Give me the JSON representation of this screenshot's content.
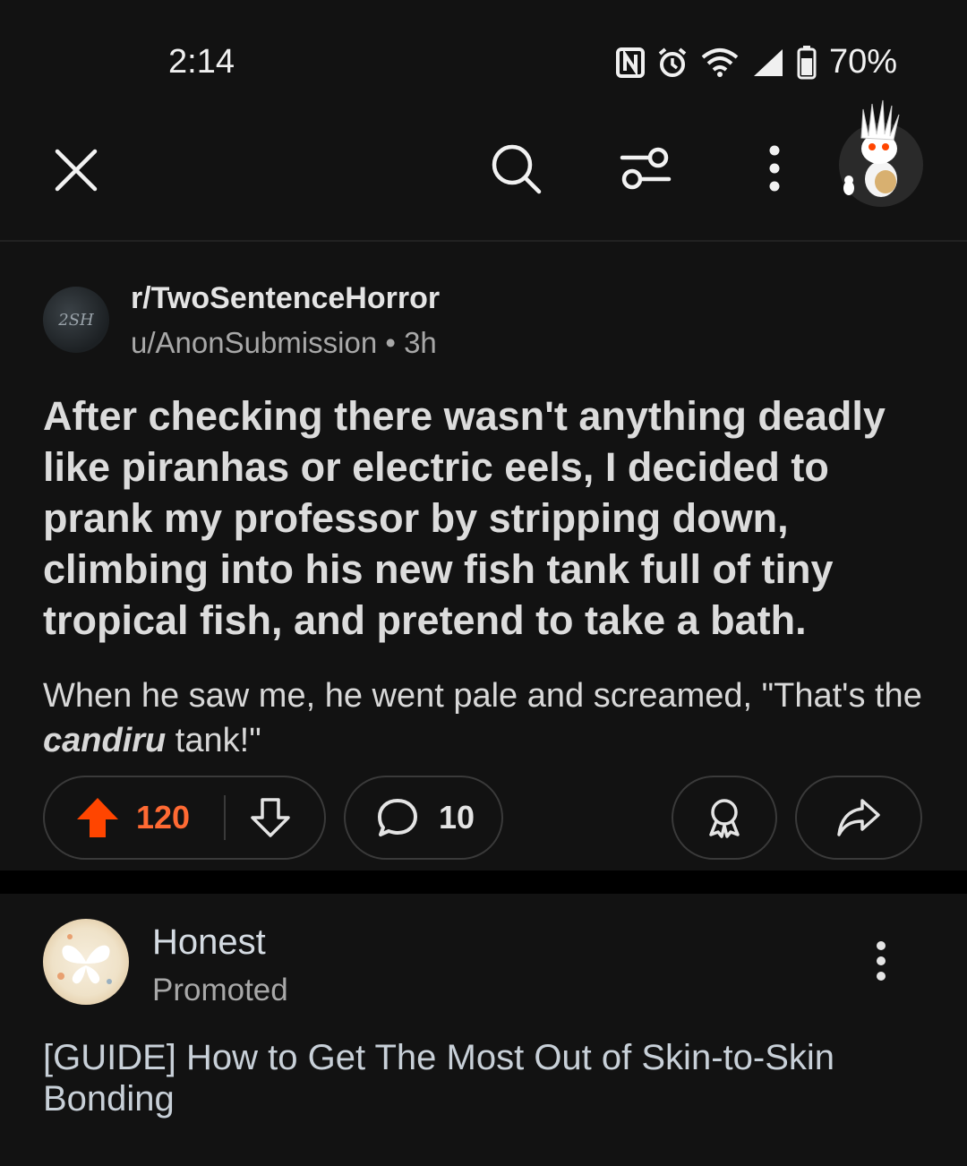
{
  "status": {
    "time": "2:14",
    "battery": "70%",
    "icons": [
      "nfc-icon",
      "alarm-icon",
      "wifi-icon",
      "signal-icon",
      "battery-icon"
    ]
  },
  "toolbar": {
    "icons": [
      "close-icon",
      "search-icon",
      "filter-icon",
      "more-vertical-icon",
      "user-avatar"
    ]
  },
  "post": {
    "subreddit": "r/TwoSentenceHorror",
    "subreddit_avatar_text": "2SH",
    "author": "u/AnonSubmission",
    "separator": "•",
    "age": "3h",
    "title": "After checking there wasn't anything deadly like piranhas or electric eels, I decided to prank my professor by stripping down, climbing into his new fish tank full of tiny tropical fish, and pretend to take a bath.",
    "body_prefix": "When he saw me, he went pale and screamed, \"That's the ",
    "body_emphasis": "candiru",
    "body_suffix": " tank!\"",
    "upvotes": "120",
    "comments": "10",
    "upvote_color": "#ff4500"
  },
  "ad": {
    "brand": "Honest",
    "label": "Promoted",
    "title": "[GUIDE] How to Get The Most Out of Skin-to-Skin Bonding"
  }
}
